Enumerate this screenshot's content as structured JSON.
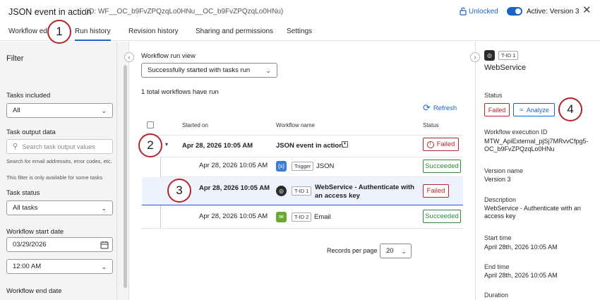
{
  "header": {
    "title": "JSON event in action",
    "id_text": "(ID: WF__OC_b9FvZPQzqLo0HNu__OC_b9FvZPQzqLo0HNu)",
    "unlocked_label": "Unlocked",
    "active_label": "Active: Version 3",
    "close_icon": "close-icon"
  },
  "tabs": [
    {
      "label": "Workflow edi"
    },
    {
      "label": "Run history"
    },
    {
      "label": "Revision history"
    },
    {
      "label": "Sharing and permissions"
    },
    {
      "label": "Settings"
    }
  ],
  "markers": [
    "1",
    "2",
    "3",
    "4"
  ],
  "filter": {
    "title": "Filter",
    "tasks_included_label": "Tasks included",
    "tasks_included_value": "All",
    "task_output_label": "Task output data",
    "task_output_placeholder": "Search task output values",
    "task_output_hint": "Search for email addresses, error codes, etc.",
    "task_output_hint2": "This filter is only available for some tasks",
    "task_status_label": "Task status",
    "task_status_value": "All tasks",
    "start_date_label": "Workflow start date",
    "start_date_value": "03/29/2026",
    "start_time_value": "12:00 AM",
    "end_date_label": "Workflow end date"
  },
  "main": {
    "view_label": "Workflow run view",
    "view_value": "Successfully started with tasks run",
    "total_text": "1 total workflows have run",
    "refresh_label": "Refresh",
    "columns": {
      "started_on": "Started on",
      "workflow_name": "Workflow name",
      "status": "Status"
    },
    "workflow_row": {
      "started_on": "Apr 28, 2026 10:05 AM",
      "name": "JSON event in action",
      "status": "Failed"
    },
    "task_rows": [
      {
        "started_on": "Apr 28, 2026 10:05 AM",
        "icon": "json-trigger-icon",
        "tag": "Trigger",
        "name": "JSON",
        "status": "Succeeded"
      },
      {
        "started_on": "Apr 28, 2026 10:05 AM",
        "icon": "webservice-icon",
        "tag": "T-ID 1",
        "name": "WebService - Authenticate with an access key",
        "status": "Failed"
      },
      {
        "started_on": "Apr 28, 2026 10:05 AM",
        "icon": "email-icon",
        "tag": "T-ID 2",
        "name": "Email",
        "status": "Succeeded"
      }
    ],
    "records_label": "Records per page",
    "records_value": "20"
  },
  "details": {
    "tid": "T-ID 1",
    "title": "WebService",
    "status_label": "Status",
    "status_value": "Failed",
    "analyze_label": "Analyze",
    "exec_id_label": "Workflow execution ID",
    "exec_id_value": "MTW_ApiExternal_pjSj7MRvvCfpg5-OC_b9FvZPQzqLo0HNu",
    "version_label": "Version name",
    "version_value": "Version 3",
    "description_label": "Description",
    "description_value": "WebService - Authenticate with an access key",
    "start_time_label": "Start time",
    "start_time_value": "April 28th, 2026 10:05 AM",
    "end_time_label": "End time",
    "end_time_value": "April 28th, 2026 10:05 AM",
    "duration_label": "Duration"
  },
  "colors": {
    "accent": "#1b64c7",
    "failed": "#b3262b",
    "succeeded": "#2e8a34",
    "marker": "#b3262b"
  }
}
